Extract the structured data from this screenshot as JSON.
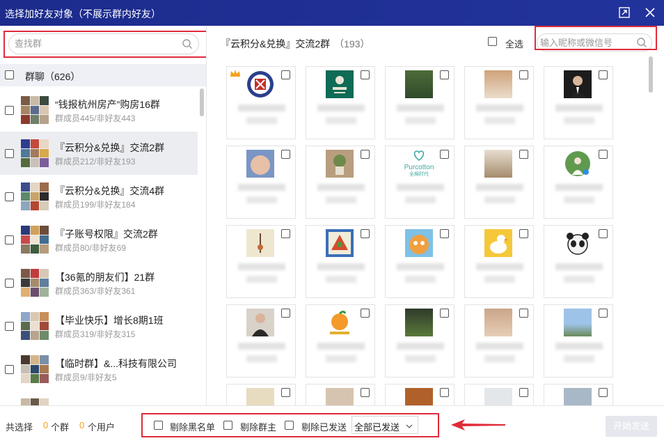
{
  "window": {
    "title": "选择加好友对象（不展示群内好友）"
  },
  "left": {
    "search_placeholder": "查找群",
    "header_label": "群聊（626）",
    "groups": [
      {
        "name": "“钱报杭州房产”购房16群",
        "sub": "群成员445/非好友443",
        "selected": false
      },
      {
        "name": "『云积分&兑换』交流2群",
        "sub": "群成员212/非好友193",
        "selected": true
      },
      {
        "name": "『云积分&兑换』交流4群",
        "sub": "群成员199/非好友184",
        "selected": false
      },
      {
        "name": "『子账号权限』交流2群",
        "sub": "群成员80/非好友69",
        "selected": false
      },
      {
        "name": "【36氪的朋友们】21群",
        "sub": "群成员363/非好友361",
        "selected": false
      },
      {
        "name": "【毕业快乐】增长8期1班",
        "sub": "群成员319/非好友315",
        "selected": false
      },
      {
        "name": "【临时群】&...科技有限公司",
        "sub": "群成员9/非好友5",
        "selected": false
      }
    ]
  },
  "right": {
    "group_title": "『云积分&兑换』交流2群",
    "count": "（193）",
    "select_all_label": "全选",
    "nick_placeholder": "输入昵称或微信号",
    "purcotton_text": "Purcotton",
    "purcotton_sub": "全棉时代"
  },
  "bottom": {
    "total_label": "共选择",
    "group_count": "0",
    "group_unit": "个群",
    "user_count": "0",
    "user_unit": "个用户",
    "opt_blacklist": "剔除黑名单",
    "opt_owner": "剔除群主",
    "opt_sent": "剔除已发送",
    "sent_select": "全部已发送",
    "start_button": "开始发送"
  },
  "colors": {
    "titlebar": "#1f2f94",
    "highlight_red": "#e02b3a",
    "count_orange": "#f0a020"
  }
}
